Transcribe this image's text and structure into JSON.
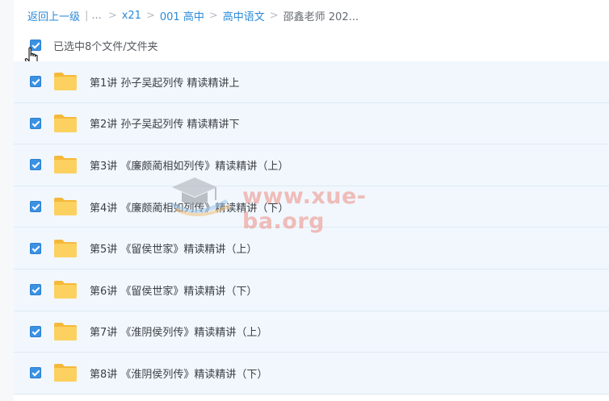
{
  "breadcrumb": {
    "back": "返回上一级",
    "separator": "|",
    "ellipsis": "...",
    "arrow": ">",
    "items": [
      "x21",
      "001 高中",
      "高中语文"
    ],
    "current": "邵鑫老师 202..."
  },
  "selection": {
    "status": "已选中8个文件/文件夹",
    "all_checked": true
  },
  "files": [
    {
      "name": "第1讲 孙子吴起列传 精读精讲上",
      "checked": true,
      "icon": "folder-icon"
    },
    {
      "name": "第2讲 孙子吴起列传 精读精讲下",
      "checked": true,
      "icon": "folder-icon"
    },
    {
      "name": "第3讲 《廉颇蔺相如列传》精读精讲（上）",
      "checked": true,
      "icon": "folder-icon"
    },
    {
      "name": "第4讲 《廉颇蔺相如列传》精读精讲（下）",
      "checked": true,
      "icon": "folder-icon"
    },
    {
      "name": "第5讲 《留侯世家》精读精讲（上）",
      "checked": true,
      "icon": "folder-icon"
    },
    {
      "name": "第6讲 《留侯世家》精读精讲（下）",
      "checked": true,
      "icon": "folder-icon"
    },
    {
      "name": "第7讲 《淮阴侯列传》精读精讲（上）",
      "checked": true,
      "icon": "folder-icon"
    },
    {
      "name": "第8讲 《淮阴侯列传》精读精讲（下）",
      "checked": true,
      "icon": "folder-icon"
    }
  ],
  "watermark": {
    "text": "www.xue-ba.org"
  },
  "colors": {
    "link": "#2b8ad8",
    "checkbox": "#3b92e3",
    "row_selected": "#f1f7fd",
    "folder": "#f8c94a",
    "watermark": "#ec8c82"
  }
}
